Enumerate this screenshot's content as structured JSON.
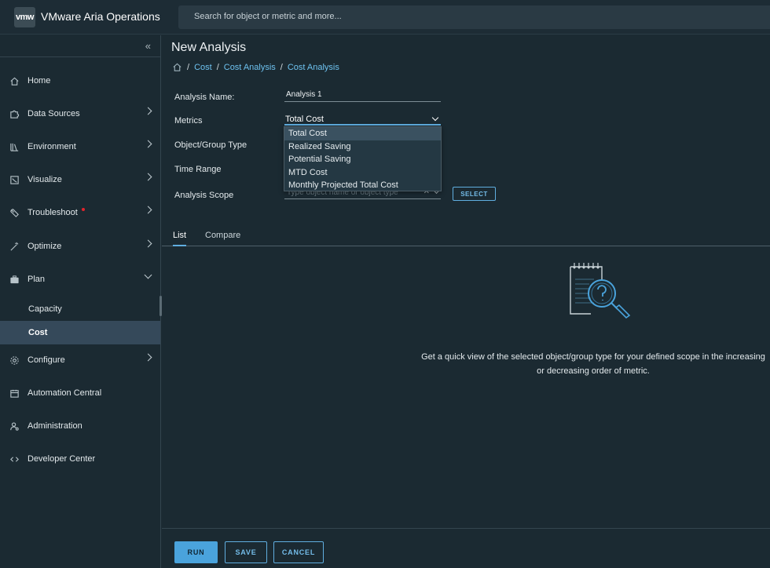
{
  "header": {
    "logo_text": "vmw",
    "app_title": "VMware Aria Operations",
    "search_placeholder": "Search for object or metric and more..."
  },
  "sidebar": {
    "collapse_icon": "double-chevron-left-icon",
    "items": [
      {
        "label": "Home",
        "icon": "home-icon"
      },
      {
        "label": "Data Sources",
        "icon": "puzzle-icon"
      },
      {
        "label": "Environment",
        "icon": "books-icon"
      },
      {
        "label": "Visualize",
        "icon": "chart-icon"
      },
      {
        "label": "Troubleshoot",
        "icon": "wrench-icon"
      },
      {
        "label": "Optimize",
        "icon": "magic-wand-icon"
      },
      {
        "label": "Plan",
        "icon": "briefcase-icon"
      },
      {
        "label": "Configure",
        "icon": "gear-icon"
      },
      {
        "label": "Automation Central",
        "icon": "calendar-icon"
      },
      {
        "label": "Administration",
        "icon": "user-gear-icon"
      },
      {
        "label": "Developer Center",
        "icon": "code-icon"
      }
    ],
    "plan_subitems": [
      {
        "label": "Capacity"
      },
      {
        "label": "Cost"
      }
    ]
  },
  "main": {
    "title": "New Analysis",
    "breadcrumb": [
      "Cost",
      "Cost Analysis",
      "Cost Analysis"
    ],
    "form": {
      "analysis_name_label": "Analysis Name:",
      "analysis_name_value": "Analysis 1",
      "metrics_label": "Metrics",
      "metrics_value": "Total Cost",
      "object_group_label": "Object/Group Type",
      "time_range_label": "Time Range",
      "analysis_scope_label": "Analysis Scope",
      "scope_placeholder": "Type object name or object type",
      "select_button": "SELECT"
    },
    "metrics_options": [
      "Total Cost",
      "Realized Saving",
      "Potential Saving",
      "MTD Cost",
      "Monthly Projected Total Cost"
    ],
    "tabs": [
      "List",
      "Compare"
    ],
    "empty_state_text": "Get a quick view of the selected object/group type for your defined scope in the increasing or decreasing order of metric."
  },
  "footer": {
    "run": "RUN",
    "save": "SAVE",
    "cancel": "CANCEL"
  },
  "colors": {
    "accent": "#4aa3dc",
    "link": "#6ec2f0",
    "background": "#1b2a32",
    "active_nav": "#35495a",
    "alert_dot": "#e2242c"
  }
}
